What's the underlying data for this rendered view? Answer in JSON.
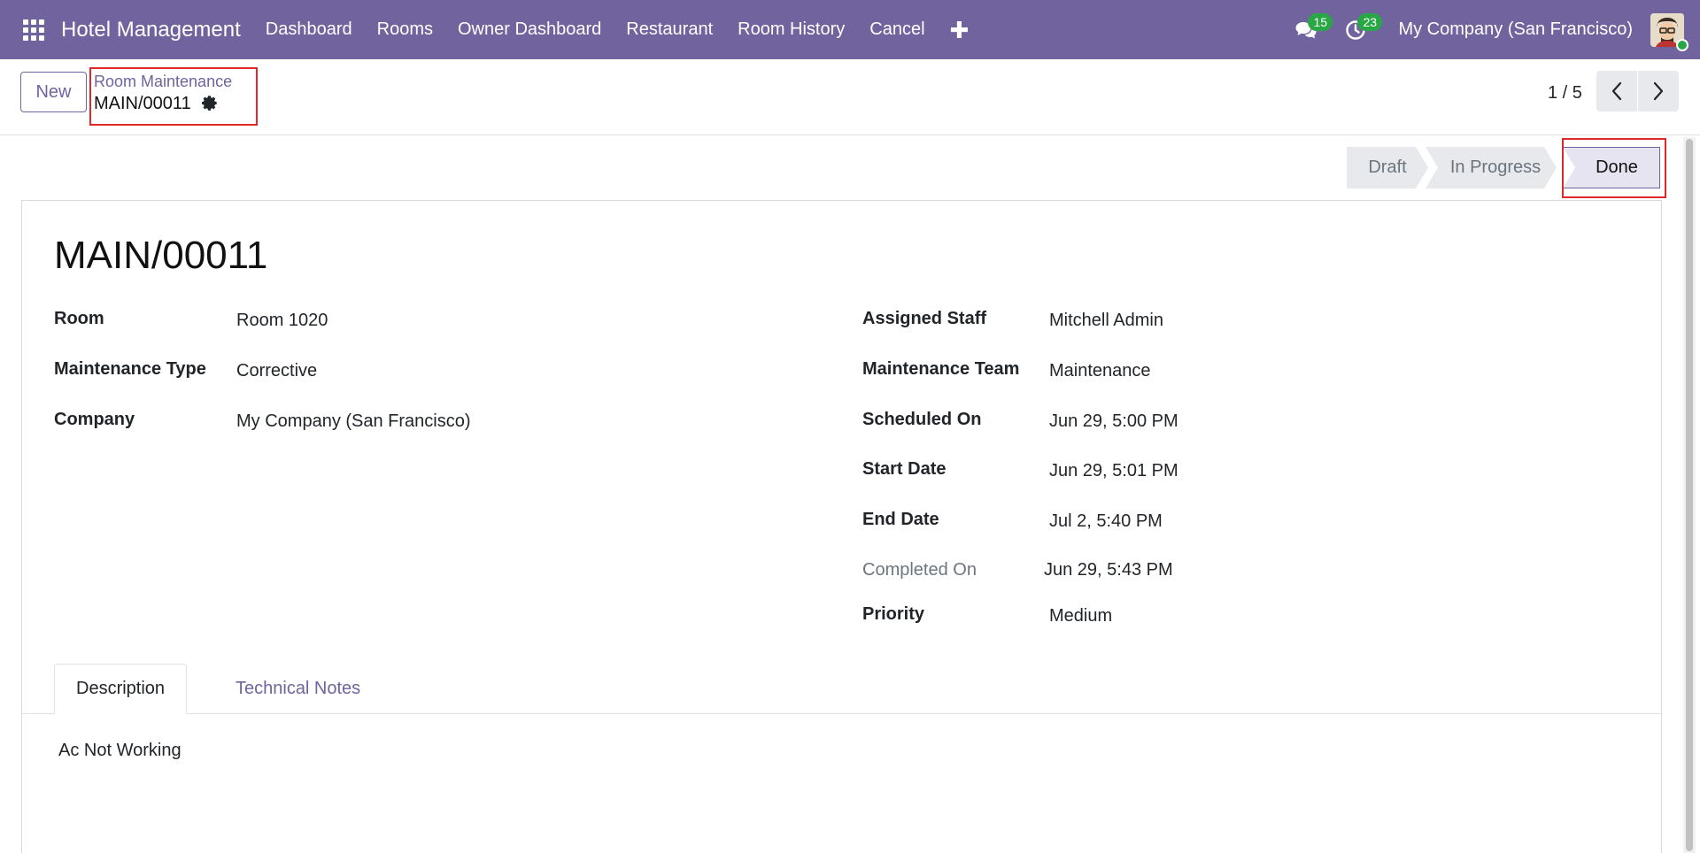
{
  "navbar": {
    "app_name": "Hotel Management",
    "menu": [
      "Dashboard",
      "Rooms",
      "Owner Dashboard",
      "Restaurant",
      "Room History",
      "Cancel"
    ],
    "messages_count": "15",
    "activities_count": "23",
    "company": "My Company (San Francisco)"
  },
  "control_panel": {
    "new_label": "New",
    "breadcrumb_parent": "Room Maintenance",
    "record_name": "MAIN/00011",
    "pager": "1 / 5"
  },
  "status": {
    "stages": [
      "Draft",
      "In Progress",
      "Done"
    ],
    "current": "Done"
  },
  "form": {
    "title": "MAIN/00011",
    "left_fields": [
      {
        "label": "Room",
        "value": "Room 1020"
      },
      {
        "label": "Maintenance Type",
        "value": "Corrective"
      },
      {
        "label": "Company",
        "value": "My Company (San Francisco)"
      }
    ],
    "right_fields": [
      {
        "label": "Assigned Staff",
        "value": "Mitchell Admin"
      },
      {
        "label": "Maintenance Team",
        "value": "Maintenance"
      },
      {
        "label": "Scheduled On",
        "value": "Jun 29, 5:00 PM"
      },
      {
        "label": "Start Date",
        "value": "Jun 29, 5:01 PM"
      },
      {
        "label": "End Date",
        "value": "Jul 2, 5:40 PM"
      },
      {
        "label": "Completed On",
        "value": "Jun 29, 5:43 PM"
      },
      {
        "label": "Priority",
        "value": "Medium"
      }
    ]
  },
  "tabs": {
    "items": [
      "Description",
      "Technical Notes"
    ],
    "active": "Description",
    "description_text": "Ac Not Working"
  },
  "colors": {
    "brand": "#71639e",
    "badge": "#28a745",
    "highlight": "#e02828"
  },
  "icons": [
    "apps-grid-icon",
    "plus-icon",
    "chat-icon",
    "clock-icon",
    "gear-icon",
    "chevron-left-icon",
    "chevron-right-icon"
  ]
}
